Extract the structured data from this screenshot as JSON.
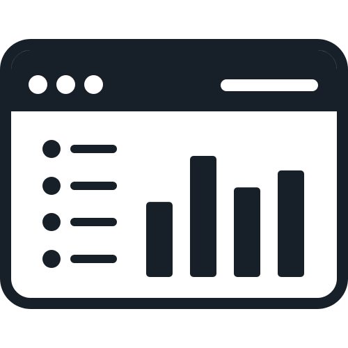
{
  "icon": {
    "name": "browser-dashboard-icon",
    "color_primary": "#172028",
    "color_background": "#ffffff"
  },
  "window": {
    "titlebar": {
      "controls": [
        "window-control-dot",
        "window-control-dot",
        "window-control-dot"
      ],
      "address_bar_icon": "address-bar-pill"
    }
  },
  "list": {
    "items": [
      {
        "bullet_icon": "bullet-dot-icon",
        "line_icon": "text-line-icon"
      },
      {
        "bullet_icon": "bullet-dot-icon",
        "line_icon": "text-line-icon"
      },
      {
        "bullet_icon": "bullet-dot-icon",
        "line_icon": "text-line-icon"
      },
      {
        "bullet_icon": "bullet-dot-icon",
        "line_icon": "text-line-icon"
      }
    ]
  },
  "chart_data": {
    "type": "bar",
    "values": [
      0.62,
      1.0,
      0.74,
      0.88
    ],
    "ylim": [
      0,
      1
    ],
    "grid": false,
    "title": "",
    "xlabel": "",
    "ylabel": "",
    "bar_color": "#172028"
  }
}
